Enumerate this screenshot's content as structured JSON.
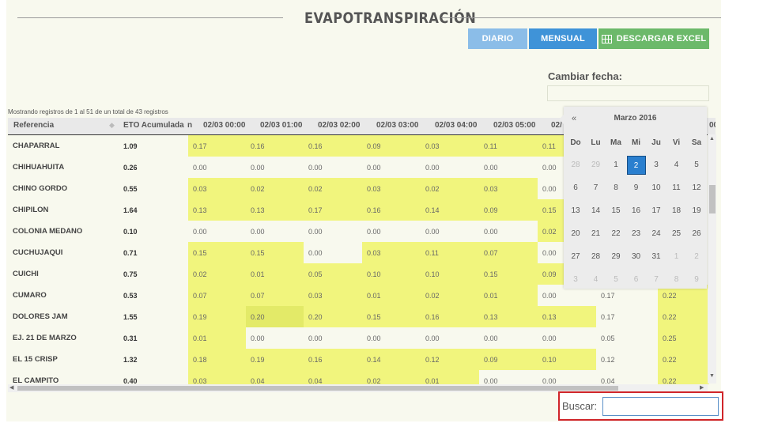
{
  "page": {
    "title": "EVAPOTRANSPIRACIÓN",
    "buttons": {
      "diario": "DIARIO",
      "mensual": "MENSUAL",
      "excel": "DESCARGAR EXCEL"
    },
    "cambiar_fecha_label": "Cambiar fecha:",
    "showing_text": "Mostrando registros de 1 al 51 de un total de 43 registros",
    "search_label": "Buscar:",
    "search_value": ""
  },
  "colors": {
    "accent_blue": "#3f93d8",
    "light_blue": "#8bbde8",
    "green": "#6cb96a",
    "highlight": "#f1f57d",
    "red_frame": "#d0252a"
  },
  "table": {
    "headers": [
      "Referencia",
      "ETO Acumulada",
      "n",
      "02/03 00:00",
      "02/03 01:00",
      "02/03 02:00",
      "02/03 03:00",
      "02/03 04:00",
      "02/03 05:00",
      "02/",
      "00"
    ],
    "rows": [
      {
        "ref": "CHAPARRAL",
        "eto": "1.09",
        "vals": [
          "0.17",
          "0.16",
          "0.16",
          "0.09",
          "0.03",
          "0.11",
          "0.11"
        ],
        "hl": [
          1,
          1,
          1,
          1,
          1,
          1,
          1
        ]
      },
      {
        "ref": "CHIHUAHUITA",
        "eto": "0.26",
        "vals": [
          "0.00",
          "0.00",
          "0.00",
          "0.00",
          "0.00",
          "0.00",
          "0.00"
        ],
        "hl": [
          0,
          0,
          0,
          0,
          0,
          0,
          0
        ]
      },
      {
        "ref": "CHINO GORDO",
        "eto": "0.55",
        "vals": [
          "0.03",
          "0.02",
          "0.02",
          "0.03",
          "0.02",
          "0.03",
          "0.00"
        ],
        "hl": [
          1,
          1,
          1,
          1,
          1,
          1,
          0
        ]
      },
      {
        "ref": "CHIPILON",
        "eto": "1.64",
        "vals": [
          "0.13",
          "0.13",
          "0.17",
          "0.16",
          "0.14",
          "0.09",
          "0.15"
        ],
        "hl": [
          1,
          1,
          1,
          1,
          1,
          1,
          1
        ]
      },
      {
        "ref": "COLONIA MEDANO",
        "eto": "0.10",
        "vals": [
          "0.00",
          "0.00",
          "0.00",
          "0.00",
          "0.00",
          "0.00",
          "0.02"
        ],
        "hl": [
          0,
          0,
          0,
          0,
          0,
          0,
          1
        ]
      },
      {
        "ref": "CUCHUJAQUI",
        "eto": "0.71",
        "vals": [
          "0.15",
          "0.15",
          "0.00",
          "0.03",
          "0.11",
          "0.07",
          "0.00"
        ],
        "hl": [
          1,
          1,
          0,
          1,
          1,
          1,
          0
        ]
      },
      {
        "ref": "CUICHI",
        "eto": "0.75",
        "vals": [
          "0.02",
          "0.01",
          "0.05",
          "0.10",
          "0.10",
          "0.15",
          "0.09"
        ],
        "hl": [
          1,
          1,
          1,
          1,
          1,
          1,
          1
        ]
      },
      {
        "ref": "CUMARO",
        "eto": "0.53",
        "vals": [
          "0.07",
          "0.07",
          "0.03",
          "0.01",
          "0.02",
          "0.01",
          "0.00"
        ],
        "hl": [
          1,
          1,
          1,
          1,
          1,
          1,
          0
        ],
        "extra": [
          "0.17",
          "0.22"
        ]
      },
      {
        "ref": "DOLORES JAM",
        "eto": "1.55",
        "vals": [
          "0.19",
          "0.20",
          "0.20",
          "0.15",
          "0.16",
          "0.13",
          "0.13"
        ],
        "hl": [
          1,
          2,
          1,
          1,
          1,
          1,
          1
        ],
        "extra": [
          "0.17",
          "0.22"
        ]
      },
      {
        "ref": "EJ. 21 DE MARZO",
        "eto": "0.31",
        "vals": [
          "0.01",
          "0.00",
          "0.00",
          "0.00",
          "0.00",
          "0.00",
          "0.00"
        ],
        "hl": [
          1,
          0,
          0,
          0,
          0,
          0,
          0
        ],
        "extra": [
          "0.05",
          "0.25"
        ]
      },
      {
        "ref": "EL 15 CRISP",
        "eto": "1.32",
        "vals": [
          "0.18",
          "0.19",
          "0.16",
          "0.14",
          "0.12",
          "0.09",
          "0.10"
        ],
        "hl": [
          1,
          1,
          1,
          1,
          1,
          1,
          1
        ],
        "extra": [
          "0.12",
          "0.22"
        ]
      },
      {
        "ref": "EL CAMPITO",
        "eto": "0.40",
        "vals": [
          "0.03",
          "0.04",
          "0.04",
          "0.02",
          "0.01",
          "0.00",
          "0.00"
        ],
        "hl": [
          1,
          1,
          1,
          1,
          1,
          0,
          0
        ],
        "extra": [
          "0.04",
          "0.22"
        ]
      }
    ]
  },
  "calendar": {
    "prev": "«",
    "title": "Marzo 2016",
    "dow": [
      "Do",
      "Lu",
      "Ma",
      "Mi",
      "Ju",
      "Vi",
      "Sa"
    ],
    "weeks": [
      [
        "28",
        "29",
        "1",
        "2",
        "3",
        "4",
        "5"
      ],
      [
        "6",
        "7",
        "8",
        "9",
        "10",
        "11",
        "12"
      ],
      [
        "13",
        "14",
        "15",
        "16",
        "17",
        "18",
        "19"
      ],
      [
        "20",
        "21",
        "22",
        "23",
        "24",
        "25",
        "26"
      ],
      [
        "27",
        "28",
        "29",
        "30",
        "31",
        "1",
        "2"
      ],
      [
        "3",
        "4",
        "5",
        "6",
        "7",
        "8",
        "9"
      ]
    ],
    "selected": "2"
  },
  "icons": {
    "sort": "sort-icon",
    "excel": "table-grid-icon",
    "prev": "double-chevron-left-icon"
  }
}
